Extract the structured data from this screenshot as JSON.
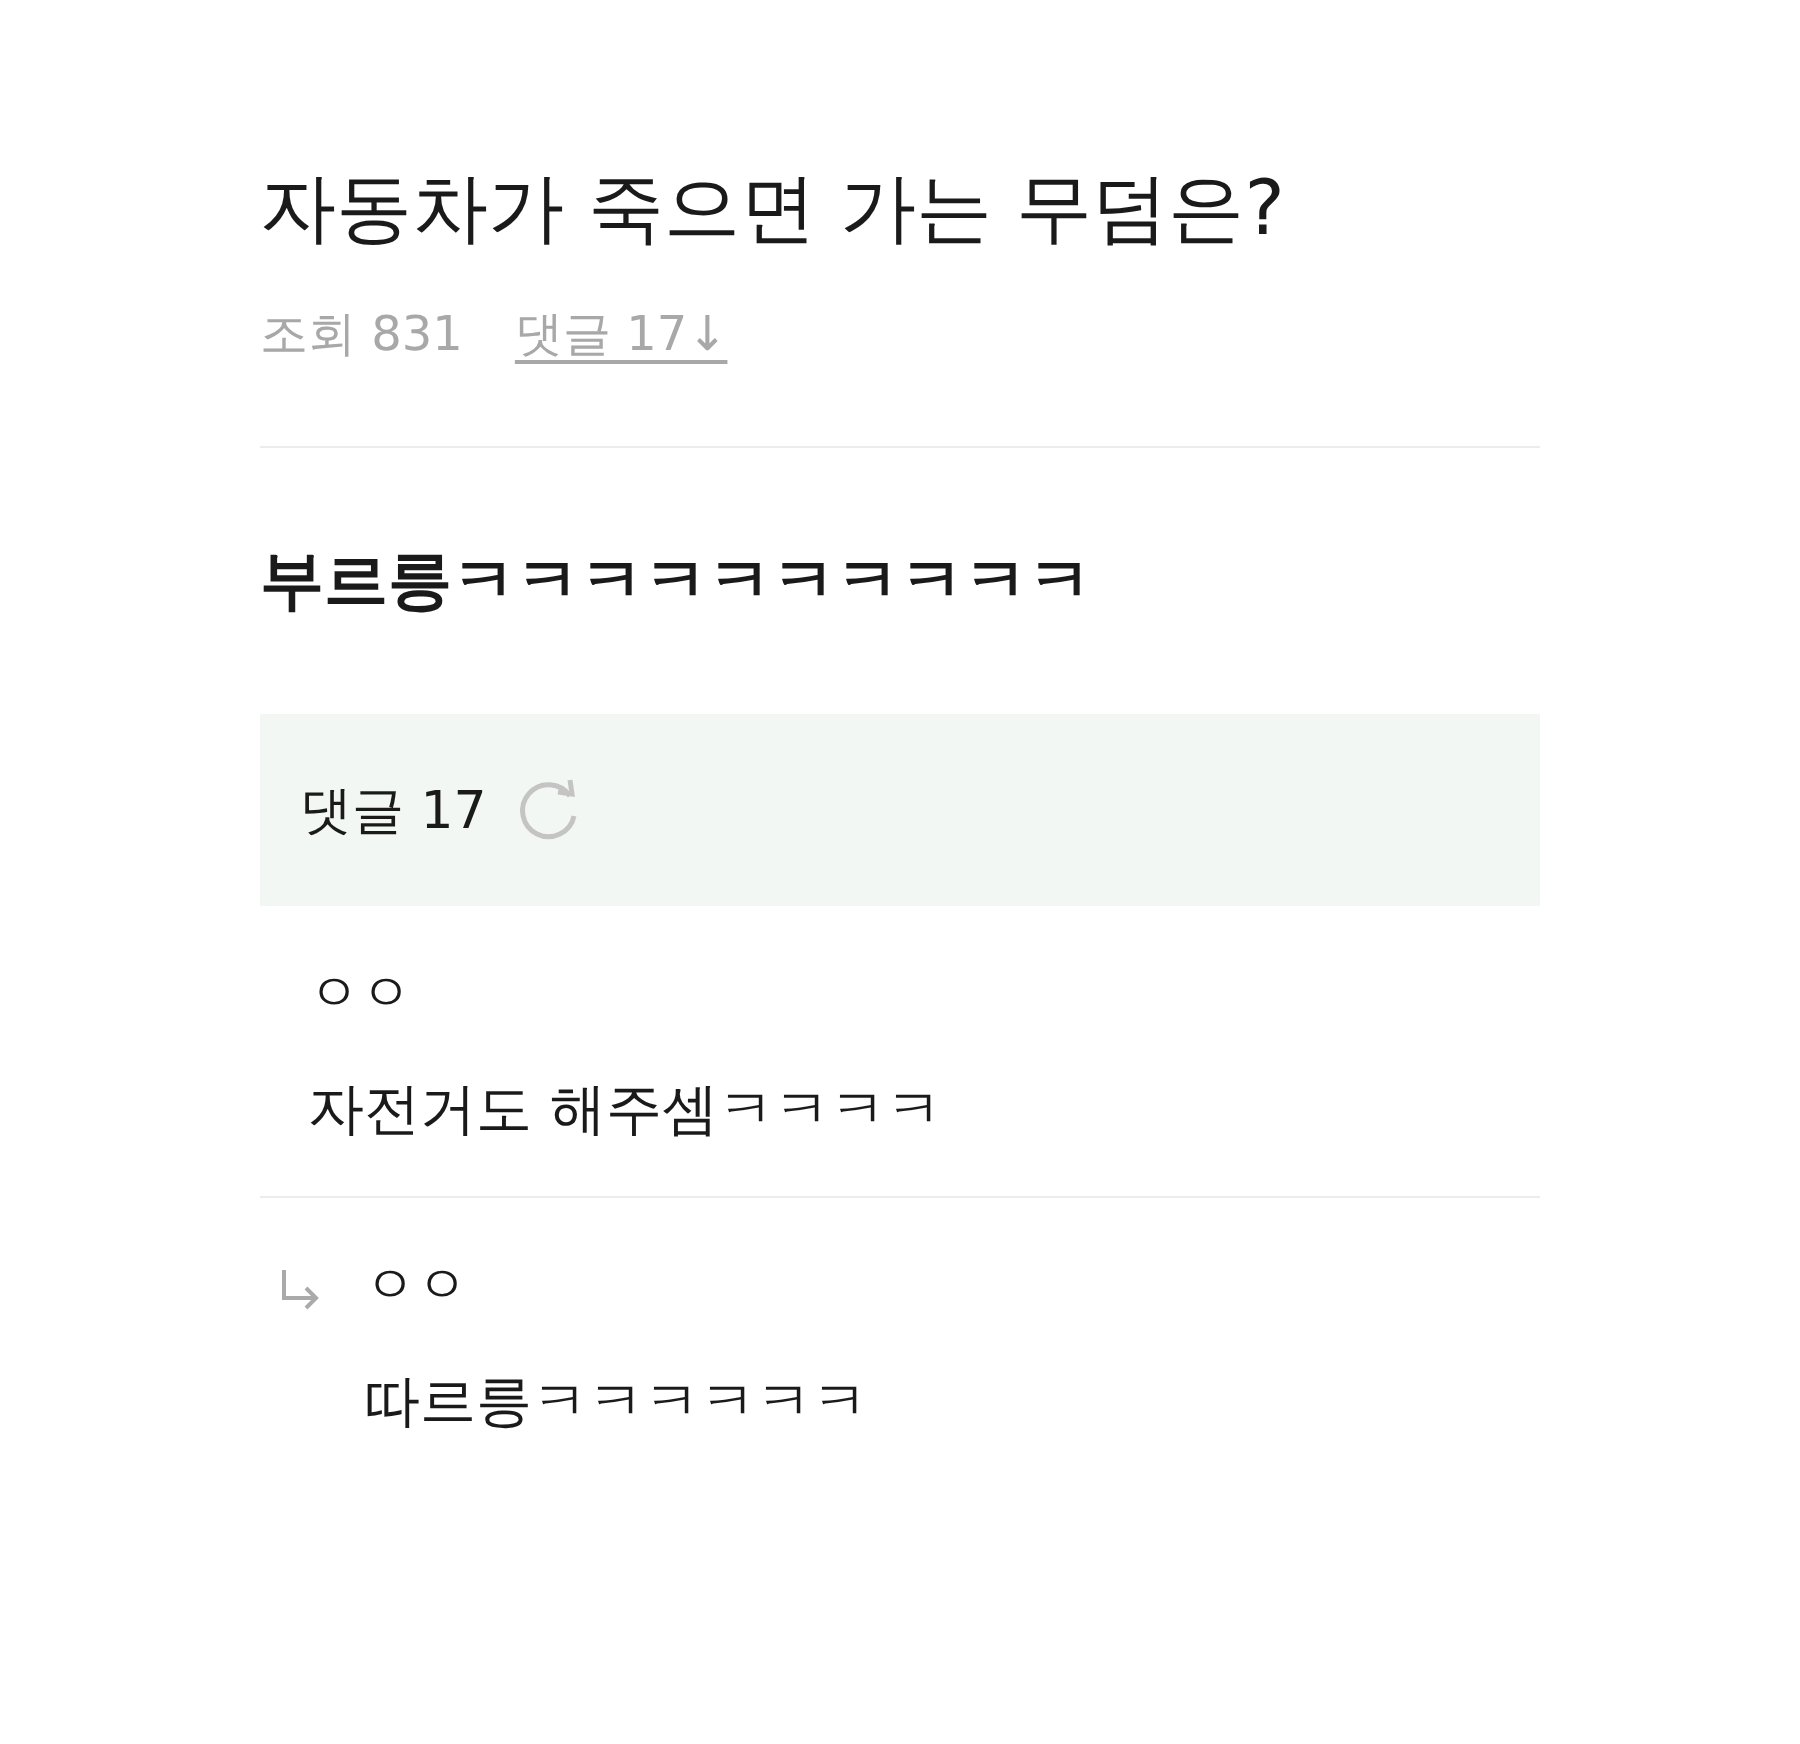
{
  "post": {
    "title": "자동차가 죽으면 가는 무덤은?",
    "views_label": "조회 831",
    "comments_link": "댓글 17↓",
    "body": "부르릉ㅋㅋㅋㅋㅋㅋㅋㅋㅋㅋ"
  },
  "comments_header": {
    "label": "댓글 17"
  },
  "comments": [
    {
      "kind": "comment",
      "author": "ㅇㅇ",
      "text": "자전거도 해주셈ㅋㅋㅋㅋ"
    },
    {
      "kind": "reply",
      "author": "ㅇㅇ",
      "text": "따르릉ㅋㅋㅋㅋㅋㅋ"
    }
  ]
}
